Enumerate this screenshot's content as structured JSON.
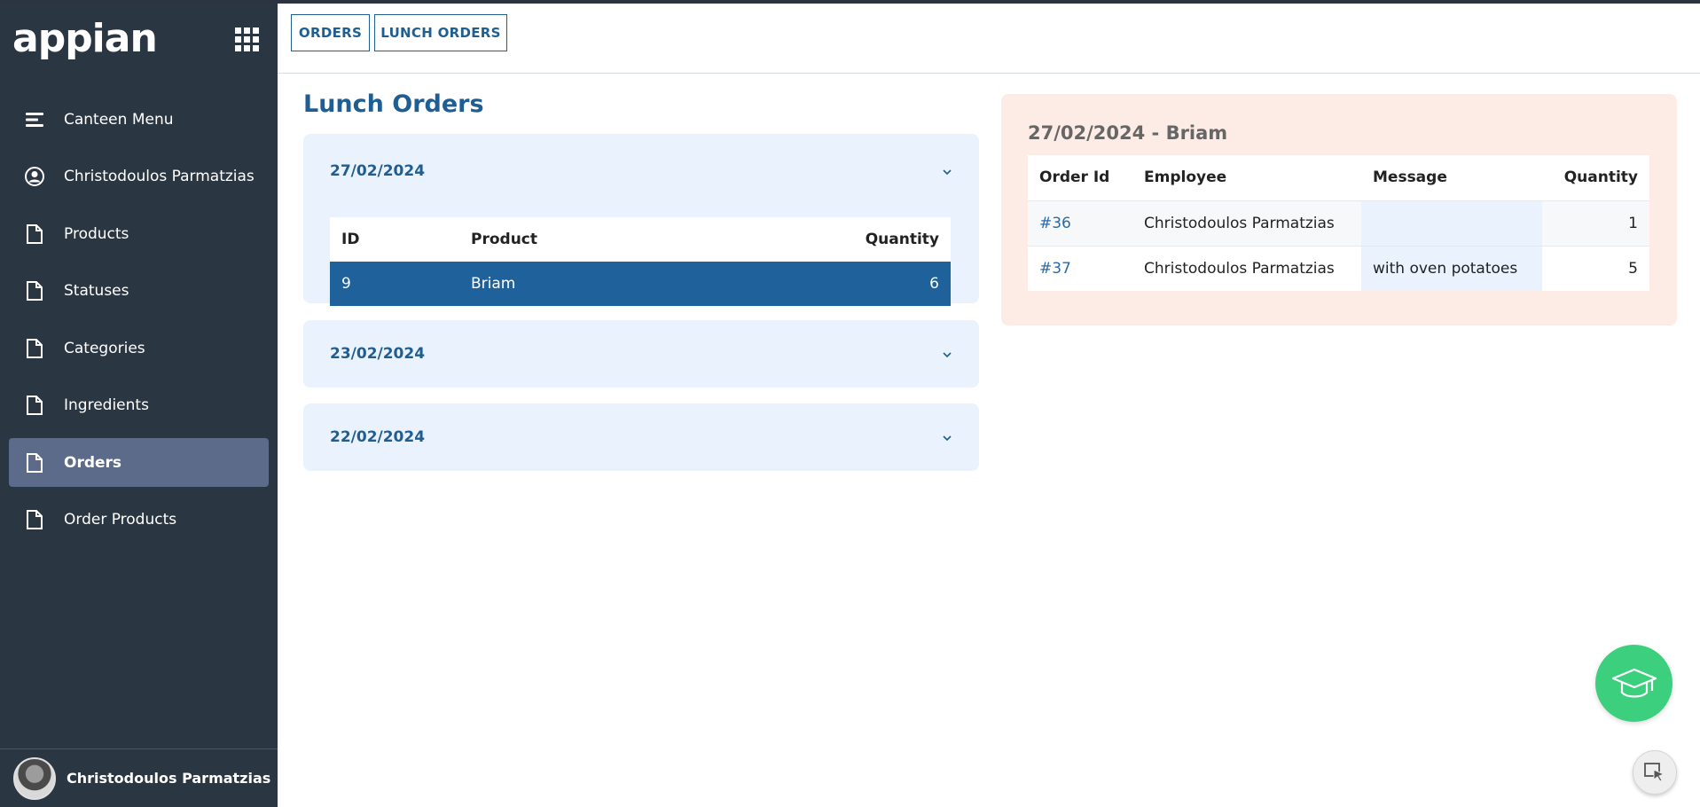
{
  "app": {
    "logo_text": "appian"
  },
  "sidebar": {
    "items": [
      {
        "label": "Canteen Menu",
        "icon": "menu-lines-icon"
      },
      {
        "label": "Christodoulos Parmatzias",
        "icon": "user-circle-icon"
      },
      {
        "label": "Products",
        "icon": "document-icon"
      },
      {
        "label": "Statuses",
        "icon": "document-icon"
      },
      {
        "label": "Categories",
        "icon": "document-icon"
      },
      {
        "label": "Ingredients",
        "icon": "document-icon"
      },
      {
        "label": "Orders",
        "icon": "document-icon",
        "active": true
      },
      {
        "label": "Order Products",
        "icon": "document-icon"
      }
    ],
    "footer": {
      "user_name": "Christodoulos Parmatzias"
    }
  },
  "header": {
    "tabs": [
      "ORDERS",
      "LUNCH ORDERS"
    ]
  },
  "main": {
    "title": "Lunch Orders",
    "groups": [
      {
        "date": "27/02/2024",
        "expanded": true,
        "columns": [
          "ID",
          "Product",
          "Quantity"
        ],
        "rows": [
          {
            "id": "9",
            "product": "Briam",
            "quantity": "6"
          }
        ]
      },
      {
        "date": "23/02/2024",
        "expanded": false
      },
      {
        "date": "22/02/2024",
        "expanded": false
      }
    ]
  },
  "detail": {
    "title": "27/02/2024 - Briam",
    "columns": [
      "Order Id",
      "Employee",
      "Message",
      "Quantity"
    ],
    "rows": [
      {
        "order_id": "#36",
        "employee": "Christodoulos Parmatzias",
        "message": "",
        "quantity": "1"
      },
      {
        "order_id": "#37",
        "employee": "Christodoulos Parmatzias",
        "message": "with oven potatoes",
        "quantity": "5"
      }
    ]
  },
  "colors": {
    "sidebar_bg": "#2b3643",
    "accent": "#1f5e93",
    "selected_row": "#1f619b",
    "detail_bg": "#fdece6",
    "fab": "#3ccf7e"
  }
}
